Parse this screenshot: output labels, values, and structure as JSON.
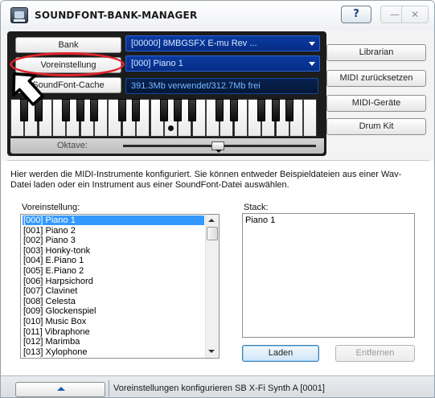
{
  "window": {
    "title": "SOUNDFONT-BANK-MANAGER",
    "help_label": "?",
    "minimize_label": "—",
    "close_label": "✕"
  },
  "top_panel": {
    "bank_button": "Bank",
    "preset_button": "Voreinstellung",
    "cache_button": "SoundFont-Cache",
    "bank_value": "[00000] 8MBGSFX E-mu Rev ...",
    "preset_value": "[000] Piano 1",
    "memory_status": "391.3Mb verwendet/312.7Mb frei",
    "octave_label": "Oktave:"
  },
  "side_buttons": {
    "librarian": "Librarian",
    "midi_reset": "MIDI zurücksetzen",
    "midi_devices": "MIDI-Geräte",
    "drum_kit": "Drum Kit"
  },
  "description": "Hier werden die MIDI-Instrumente konfiguriert. Sie können entweder Beispieldateien aus einer Wav-Datei laden oder ein Instrument aus einer SoundFont-Datei auswählen.",
  "preset_list": {
    "label": "Voreinstellung:",
    "items": [
      "[000] Piano 1",
      "[001] Piano 2",
      "[002] Piano 3",
      "[003] Honky-tonk",
      "[004] E.Piano 1",
      "[005] E.Piano 2",
      "[006] Harpsichord",
      "[007] Clavinet",
      "[008] Celesta",
      "[009] Glockenspiel",
      "[010] Music Box",
      "[011] Vibraphone",
      "[012] Marimba",
      "[013] Xylophone"
    ],
    "selected_index": 0
  },
  "stack": {
    "label": "Stack:",
    "items": [
      "Piano 1"
    ],
    "load_button": "Laden",
    "remove_button": "Entfernen"
  },
  "statusbar": {
    "text": "Voreinstellungen konfigurieren SB X-Fi Synth A [0001]"
  },
  "icons": {
    "app": "soundfont-app-icon",
    "pointer": "pointer-hand-icon",
    "dropdown": "chevron-down-icon",
    "expand": "chevron-up-icon"
  },
  "colors": {
    "lcd_bg": "#0a2c6a",
    "lcd_text": "#78b8ff",
    "selection": "#3399ff",
    "highlight_ring": "#e0232a",
    "panel_dark": "#1c1c1c"
  }
}
